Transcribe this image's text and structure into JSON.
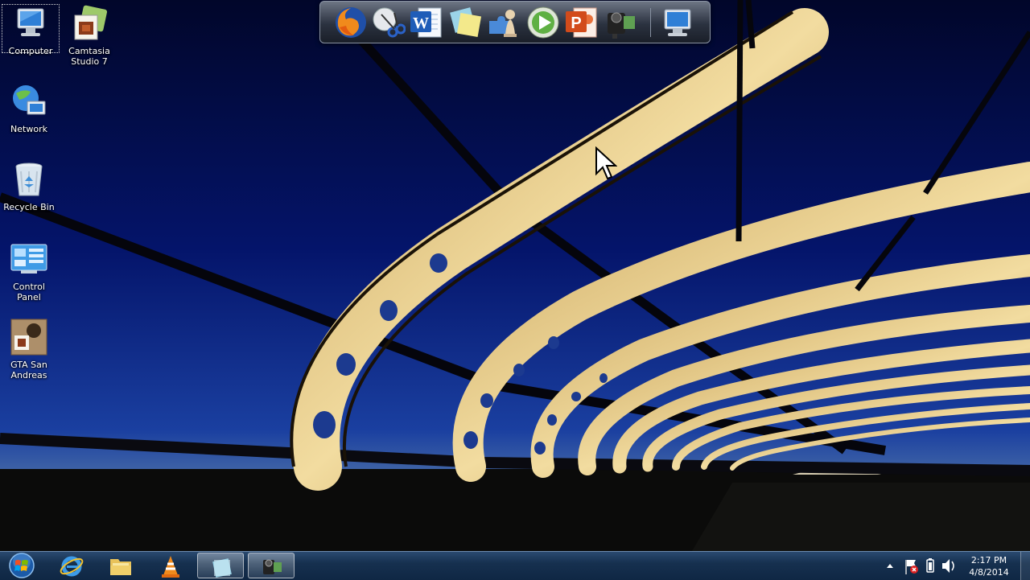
{
  "desktop": {
    "icons": [
      {
        "label": "Computer",
        "icon": "computer-icon"
      },
      {
        "label": "Camtasia\nStudio 7",
        "icon": "camtasia-icon"
      },
      {
        "label": "Network",
        "icon": "network-icon"
      },
      {
        "label": "Recycle Bin",
        "icon": "recycle-bin-icon"
      },
      {
        "label": "Control\nPanel",
        "icon": "control-panel-icon"
      },
      {
        "label": "GTA San\nAndreas",
        "icon": "gta-icon"
      }
    ]
  },
  "dock": {
    "items": [
      "firefox-icon",
      "snipping-tool-icon",
      "word-icon",
      "sticky-notes-icon",
      "puzzle-chess-icon",
      "media-player-icon",
      "powerpoint-icon",
      "camera-recorder-icon",
      "computer-icon"
    ]
  },
  "taskbar": {
    "pinned": [
      "internet-explorer-icon",
      "windows-explorer-icon",
      "vlc-icon",
      "sticky-notes-icon",
      "camtasia-recorder-icon"
    ],
    "tray": [
      "show-hidden-icons-icon",
      "action-center-icon",
      "battery-icon",
      "volume-icon"
    ],
    "time": "2:17 PM",
    "date": "4/8/2014"
  },
  "colors": {
    "taskbar": "#16304f",
    "sky_top": "#020a33",
    "sky_horizon": "#3a5a8c",
    "bridge": "#e8c98a"
  }
}
